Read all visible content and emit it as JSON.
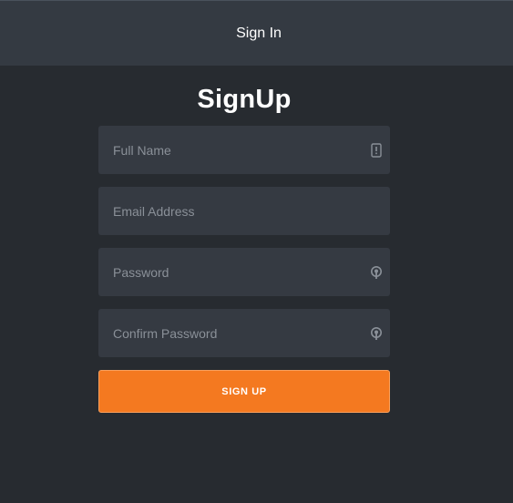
{
  "header": {
    "signin_label": "Sign In"
  },
  "form": {
    "title": "SignUp",
    "fields": [
      {
        "placeholder": "Full Name",
        "value": "",
        "icon": "id-card-icon"
      },
      {
        "placeholder": "Email Address",
        "value": ""
      },
      {
        "placeholder": "Password",
        "value": "",
        "icon": "lock-icon"
      },
      {
        "placeholder": "Confirm Password",
        "value": "",
        "icon": "lock-icon"
      }
    ],
    "submit_label": "SIGN UP"
  },
  "colors": {
    "background": "#272b30",
    "header": "#343a42",
    "field": "#353a42",
    "accent": "#f47920"
  }
}
